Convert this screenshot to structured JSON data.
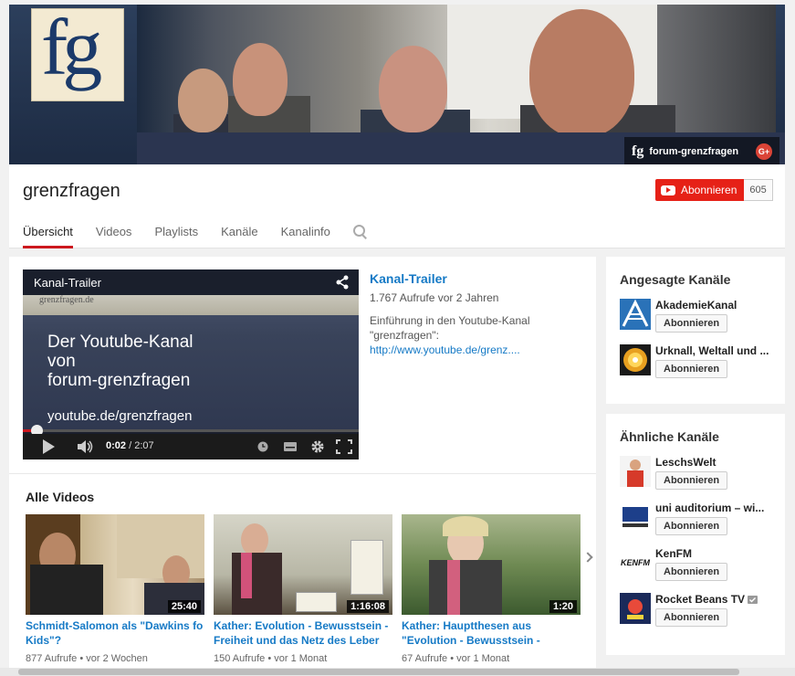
{
  "banner": {
    "logo_text": "fg",
    "link_label": "forum-grenzfragen",
    "gplus_label": "G+"
  },
  "header": {
    "channel_name": "grenzfragen",
    "subscribe_label": "Abonnieren",
    "subscriber_count": "605",
    "tabs": [
      "Übersicht",
      "Videos",
      "Playlists",
      "Kanäle",
      "Kanalinfo"
    ]
  },
  "player": {
    "title": "Kanal-Trailer",
    "band_text": "grenzfragen.de",
    "slide_lines": [
      "Der Youtube-Kanal",
      "von",
      "forum-grenzfragen"
    ],
    "slide_url": "youtube.de/grenzfragen",
    "time_current": "0:02",
    "time_total": "/ 2:07",
    "progress_fraction": 0.01
  },
  "trailer": {
    "title": "Kanal-Trailer",
    "meta": "1.767 Aufrufe  vor 2 Jahren",
    "desc": "Einführung in den Youtube-Kanal \"grenzfragen\":",
    "link": "http://www.youtube.de/grenz...."
  },
  "all_videos": {
    "title": "Alle Videos",
    "items": [
      {
        "title": "Schmidt-Salomon als \"Dawkins fo Kids\"?",
        "duration": "25:40",
        "views": "877 Aufrufe",
        "age": "vor 2 Wochen"
      },
      {
        "title": "Kather: Evolution - Bewusstsein - Freiheit und das Netz des Leber",
        "duration": "1:16:08",
        "views": "150 Aufrufe",
        "age": "vor 1 Monat"
      },
      {
        "title": "Kather: Hauptthesen aus \"Evolution - Bewusstsein - Freih…",
        "duration": "1:20",
        "views": "67 Aufrufe",
        "age": "vor 1 Monat"
      }
    ]
  },
  "featured": {
    "title": "Angesagte Kanäle",
    "channels": [
      {
        "name": "AkademieKanal",
        "button": "Abonnieren"
      },
      {
        "name": "Urknall, Weltall und ...",
        "button": "Abonnieren"
      }
    ]
  },
  "related": {
    "title": "Ähnliche Kanäle",
    "channels": [
      {
        "name": "LeschsWelt",
        "button": "Abonnieren"
      },
      {
        "name": "uni auditorium – wi...",
        "button": "Abonnieren"
      },
      {
        "name": "KenFM",
        "button": "Abonnieren",
        "avatar_text": "KENFM"
      },
      {
        "name": "Rocket Beans TV",
        "button": "Abonnieren"
      }
    ]
  },
  "colors": {
    "accent": "#cc181e",
    "link": "#167ac6",
    "subscribe": "#e62117"
  }
}
